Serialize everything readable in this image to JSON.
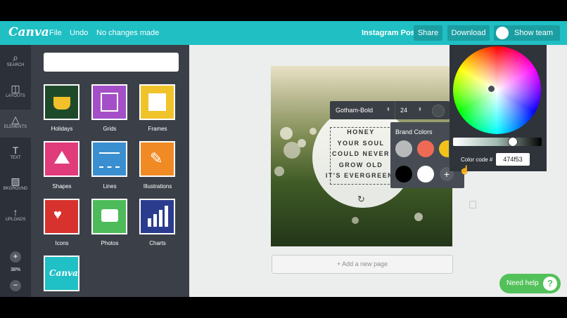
{
  "topbar": {
    "logo": "Canva",
    "menu": [
      "File",
      "Undo",
      "No changes made"
    ],
    "doc_type": "Instagram Post",
    "share_label": "Share",
    "download_label": "Download",
    "show_team_label": "Show team"
  },
  "rail": {
    "items": [
      {
        "label": "SEARCH",
        "icon": "search-icon"
      },
      {
        "label": "LAYOUTS",
        "icon": "layouts-icon"
      },
      {
        "label": "ELEMENTS",
        "icon": "elements-icon"
      },
      {
        "label": "TEXT",
        "icon": "text-icon"
      },
      {
        "label": "BKGROUND",
        "icon": "background-icon"
      },
      {
        "label": "UPLOADS",
        "icon": "upload-icon"
      }
    ],
    "zoom": "38%",
    "zoom_in": "+",
    "zoom_out": "−"
  },
  "panel": {
    "search_placeholder": "",
    "tiles": [
      {
        "label": "Holidays",
        "color": "#1f4a2a"
      },
      {
        "label": "Grids",
        "color": "#a44fc8"
      },
      {
        "label": "Frames",
        "color": "#f0c32a"
      },
      {
        "label": "Shapes",
        "color": "#e03b7a"
      },
      {
        "label": "Lines",
        "color": "#3a8fd1"
      },
      {
        "label": "Illustrations",
        "color": "#f08a24"
      },
      {
        "label": "Icons",
        "color": "#d8322f"
      },
      {
        "label": "Photos",
        "color": "#4dbb5a"
      },
      {
        "label": "Charts",
        "color": "#2b3c8f"
      },
      {
        "label": "Canva",
        "color": "#1fc0c6"
      }
    ]
  },
  "canvas": {
    "quote_lines": [
      "HONEY",
      "YOUR SOUL",
      "COULD NEVER",
      "GROW OLD",
      "IT'S EVERGREEN"
    ],
    "add_page_label": "+ Add a new page"
  },
  "text_toolbar": {
    "font": "Gotham-Bold",
    "size": "24"
  },
  "brand_colors": {
    "title": "Brand Colors",
    "swatches": [
      "#b7b9bb",
      "#ef6a55",
      "#f1c21b",
      "#000000",
      "#ffffff"
    ],
    "add": "+"
  },
  "color_picker": {
    "code_label": "Color code #",
    "code_value": "474f53"
  },
  "help": {
    "label": "Need help",
    "icon": "?"
  }
}
